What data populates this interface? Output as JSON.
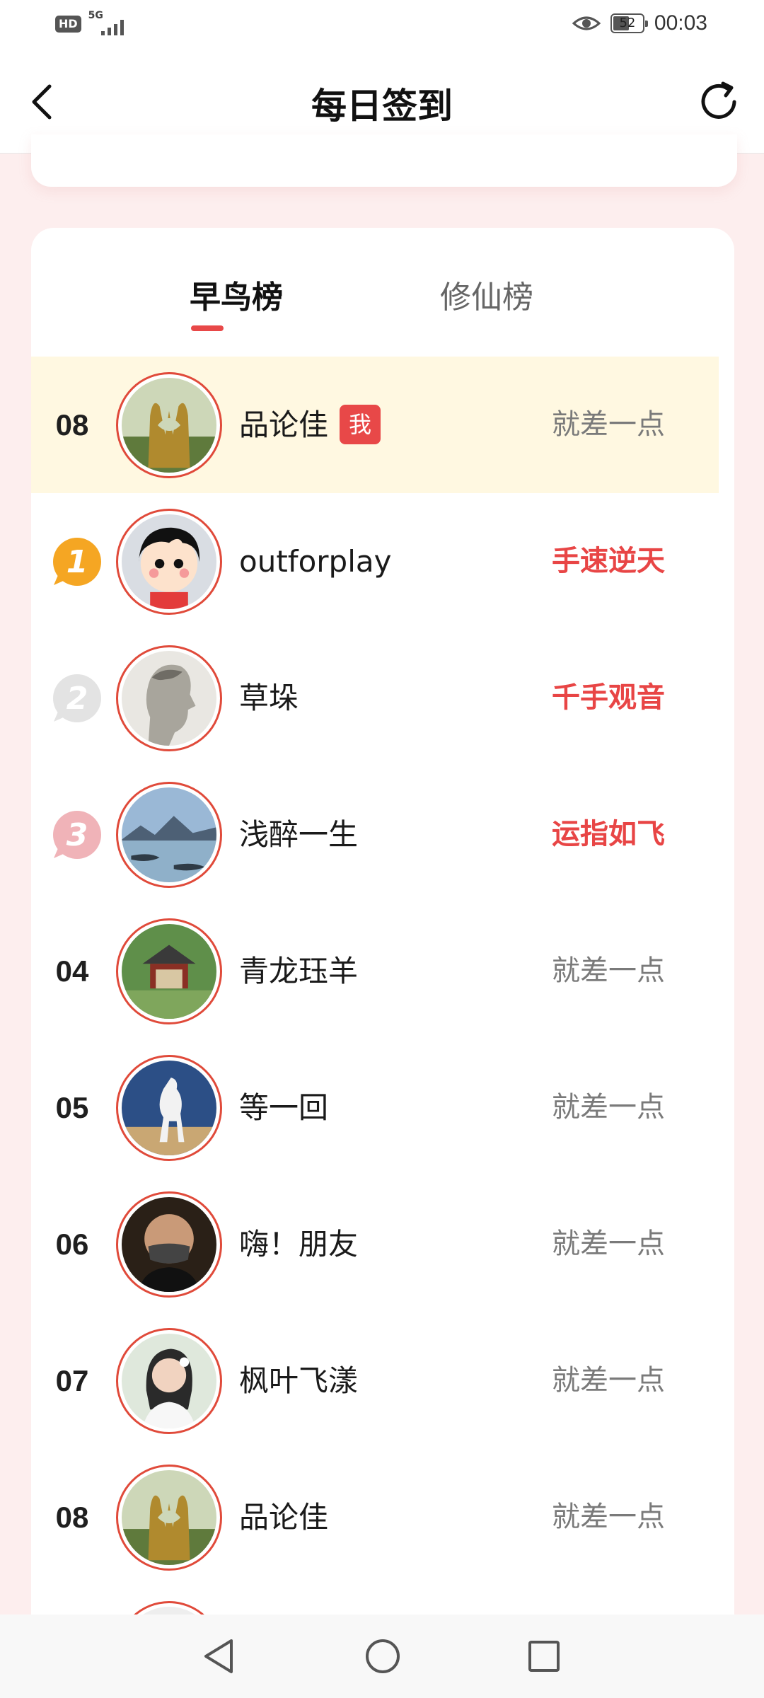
{
  "status_bar": {
    "hd_label": "HD",
    "network_label": "5G",
    "battery_level": "52",
    "time": "00:03"
  },
  "header": {
    "title": "每日签到",
    "back_icon": "chevron-left-icon",
    "refresh_icon": "refresh-icon"
  },
  "tabs": [
    {
      "label": "早鸟榜",
      "active": true
    },
    {
      "label": "修仙榜",
      "active": false
    }
  ],
  "ranking": [
    {
      "rank": "08",
      "name": "品论佳",
      "me_badge": "我",
      "status": "就差一点",
      "highlight": true,
      "avatar": "golden-hands"
    },
    {
      "rank": "1",
      "name": "outforplay",
      "status": "手速逆天",
      "medal": "gold",
      "avatar": "cartoon-girl"
    },
    {
      "rank": "2",
      "name": "草垛",
      "status": "千手观音",
      "medal": "silver",
      "avatar": "statue"
    },
    {
      "rank": "3",
      "name": "浅醉一生",
      "status": "运指如飞",
      "medal": "bronze",
      "avatar": "seascape"
    },
    {
      "rank": "04",
      "name": "青龙珏羊",
      "status": "就差一点",
      "avatar": "pavilion"
    },
    {
      "rank": "05",
      "name": "等一回",
      "status": "就差一点",
      "avatar": "white-horse"
    },
    {
      "rank": "06",
      "name": "嗨！朋友",
      "status": "就差一点",
      "avatar": "masked-man"
    },
    {
      "rank": "07",
      "name": "枫叶飞漾",
      "status": "就差一点",
      "avatar": "woman-portrait"
    },
    {
      "rank": "08",
      "name": "品论佳",
      "status": "就差一点",
      "avatar": "golden-hands"
    }
  ],
  "colors": {
    "accent": "#e84848",
    "highlight_row": "#fff8e1",
    "page_background": "#fdeeee"
  },
  "nav_bar": {
    "back_icon": "triangle-back-icon",
    "home_icon": "circle-home-icon",
    "recents_icon": "square-recents-icon"
  }
}
